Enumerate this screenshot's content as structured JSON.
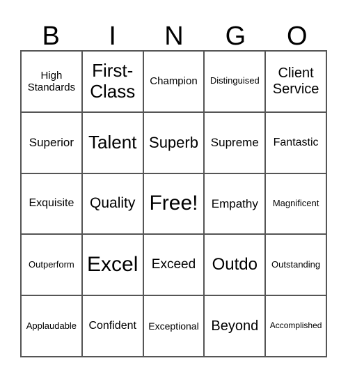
{
  "header": [
    "B",
    "I",
    "N",
    "G",
    "O"
  ],
  "cells": [
    {
      "text": "High Standards",
      "size": 15
    },
    {
      "text": "First-Class",
      "size": 26
    },
    {
      "text": "Champion",
      "size": 15
    },
    {
      "text": "Distinguised",
      "size": 13
    },
    {
      "text": "Client Service",
      "size": 20
    },
    {
      "text": "Superior",
      "size": 17
    },
    {
      "text": "Talent",
      "size": 26
    },
    {
      "text": "Superb",
      "size": 22
    },
    {
      "text": "Supreme",
      "size": 17
    },
    {
      "text": "Fantastic",
      "size": 16
    },
    {
      "text": "Exquisite",
      "size": 16
    },
    {
      "text": "Quality",
      "size": 21
    },
    {
      "text": "Free!",
      "size": 30
    },
    {
      "text": "Empathy",
      "size": 17
    },
    {
      "text": "Magnificent",
      "size": 13
    },
    {
      "text": "Outperform",
      "size": 13
    },
    {
      "text": "Excel",
      "size": 30
    },
    {
      "text": "Exceed",
      "size": 19
    },
    {
      "text": "Outdo",
      "size": 24
    },
    {
      "text": "Outstanding",
      "size": 13
    },
    {
      "text": "Applaudable",
      "size": 13
    },
    {
      "text": "Confident",
      "size": 16
    },
    {
      "text": "Exceptional",
      "size": 14
    },
    {
      "text": "Beyond",
      "size": 20
    },
    {
      "text": "Accomplished",
      "size": 12
    }
  ]
}
